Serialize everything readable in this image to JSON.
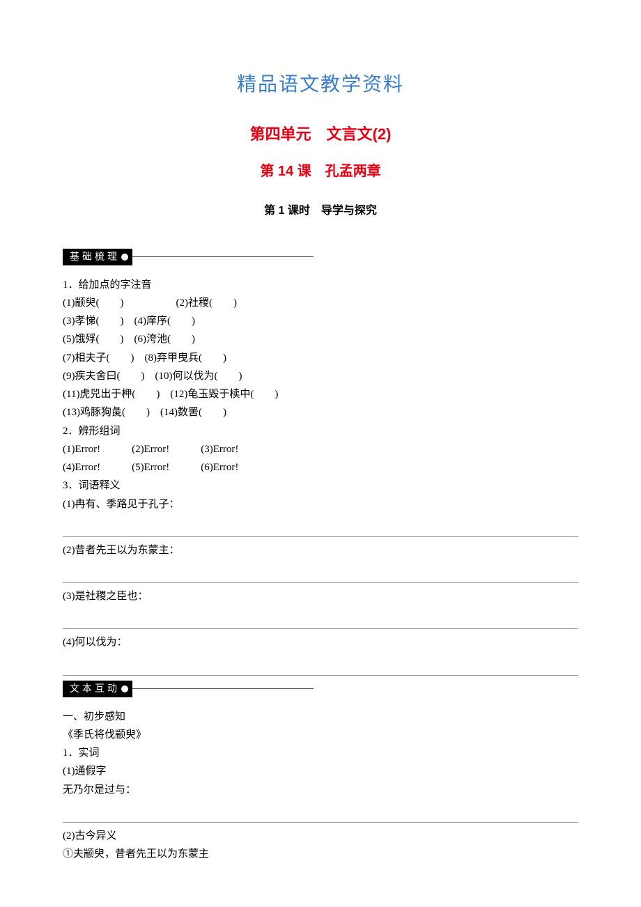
{
  "header": {
    "main_title": "精品语文教学资料",
    "unit_title": "第四单元　文言文(2)",
    "lesson_title": "第 14 课　孔孟两章",
    "section_sub": "第 1 课时　导学与探究"
  },
  "banners": {
    "basic": "基础梳理",
    "text": "文本互动"
  },
  "basic": {
    "q1_title": "1．给加点的字注音",
    "q1_items": [
      "(1)颛臾(　　)　　　　　(2)社稷(　　)",
      "(3)孝悌(　　)　(4)庠序(　　)",
      "(5)饿殍(　　)　(6)洿池(　　)",
      "(7)相夫子(　　)　(8)弃甲曳兵(　　)",
      "(9)疾夫舍曰(　　)　(10)何以伐为(　　)",
      "(11)虎兕出于柙(　　)　(12)龟玉毁于椟中(　　)",
      "(13)鸡豚狗彘(　　)　(14)数罟(　　)"
    ],
    "q2_title": "2．辨形组词",
    "q2_line1": "(1)Error!　　　(2)Error!　　　(3)Error!",
    "q2_line2": "(4)Error!　　　(5)Error!　　　(6)Error!",
    "q3_title": "3．词语释义",
    "q3_items": [
      "(1)冉有、季路见于孔子：",
      "(2)昔者先王以为东蒙主：",
      "(3)是社稷之臣也：",
      "(4)何以伐为："
    ]
  },
  "textinter": {
    "h1": "一、初步感知",
    "h2": "《季氏将伐颛臾》",
    "q1_title": "1．实词",
    "q1_sub1": "(1)通假字",
    "q1_item1": "无乃尔是过与：",
    "q1_sub2": "(2)古今异义",
    "q1_item2": "①夫颛臾，昔者先王以为东蒙主"
  }
}
